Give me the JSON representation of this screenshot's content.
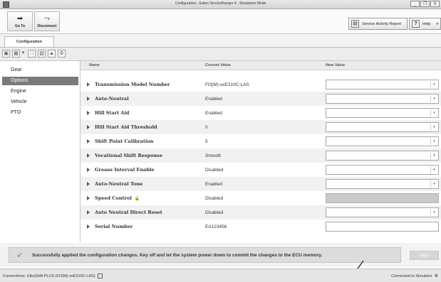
{
  "window": {
    "title": "Configuration - Eaton ServiceRanger 4 - Simulation Mode",
    "minimize": "_",
    "restore": "❐",
    "close": "X"
  },
  "toolbar": {
    "goto_label": "Go To",
    "goto_icon": "➡",
    "disconnect_label": "Disconnect",
    "disconnect_icon": "⤳",
    "sar_label": "Service Activity Report",
    "help_label": "Help",
    "help_icon": "?",
    "help_chevron": "▾"
  },
  "tabs": [
    {
      "label": "Configuration"
    }
  ],
  "nav": {
    "items": [
      {
        "label": "Gear"
      },
      {
        "label": "Options"
      },
      {
        "label": "Engine"
      },
      {
        "label": "Vehicle"
      },
      {
        "label": "PTO"
      }
    ],
    "selected_index": 1
  },
  "grid": {
    "headers": {
      "name": "Name",
      "current": "Current Value",
      "new": "New Value"
    },
    "rows": [
      {
        "name": "Transmission Model Number",
        "current": "FO(M)-xxE310C-LAS",
        "input": "dropdown"
      },
      {
        "name": "Auto-Neutral",
        "current": "Enabled",
        "input": "dropdown"
      },
      {
        "name": "Hill Start Aid",
        "current": "Enabled",
        "input": "dropdown"
      },
      {
        "name": "Hill Start Aid Threshold",
        "current": "0",
        "input": "dropdown"
      },
      {
        "name": "Shift Point Calibration",
        "current": "5",
        "input": "dropdown"
      },
      {
        "name": "Vocational Shift Response",
        "current": "Smooth",
        "input": "dropdown"
      },
      {
        "name": "Grease Interval Enable",
        "current": "Disabled",
        "input": "dropdown"
      },
      {
        "name": "Auto-Neutral Tone",
        "current": "Enabled",
        "input": "dropdown"
      },
      {
        "name": "Speed Control",
        "current": "Disabled",
        "input": "disabled"
      },
      {
        "name": "Auto Neutral Direct Reset",
        "current": "Disabled",
        "input": "dropdown"
      },
      {
        "name": "Serial Number",
        "current": "EA123456",
        "input": "text"
      }
    ]
  },
  "status": {
    "message": "Successfully applied the configuration changes.  Key off and let the system power down to commit the changes to the ECU memory.",
    "apply_label": "Apply"
  },
  "bottombar": {
    "connection": "Connections: UltraShift PLUS (FO(M)-xxE310C-LAS)",
    "simulator": "Connected to Simulator"
  },
  "colors": {
    "selected_nav": "#7a7a7a",
    "alt_row": "#f1f1f1",
    "status_bg": "#dcdcdc"
  }
}
